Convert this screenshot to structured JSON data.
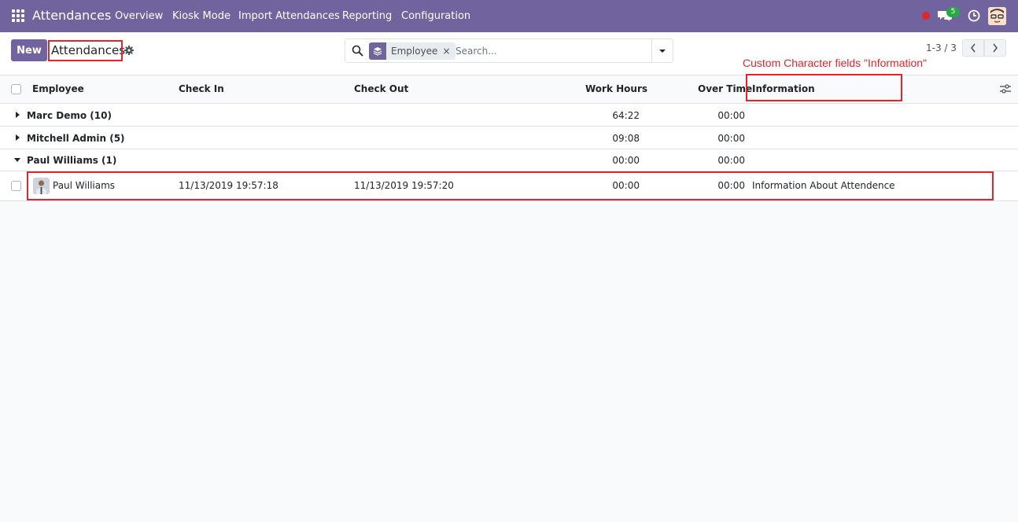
{
  "navbar": {
    "app_title": "Attendances",
    "menu": [
      "Overview",
      "Kiosk Mode",
      "Import Attendances",
      "Reporting",
      "Configuration"
    ],
    "chat_count": "5",
    "icons": [
      "apps-grid-icon",
      "record-dot-icon",
      "chat-icon",
      "clock-icon",
      "user-avatar"
    ],
    "accent_color": "#71639e"
  },
  "control": {
    "new_label": "New",
    "title": "Attendances",
    "search": {
      "facet_label": "Employee",
      "facet_close": "×",
      "placeholder": "Search..."
    },
    "pager": "1-3 / 3"
  },
  "annotation": "Custom Character fields \"Information\"",
  "table": {
    "headers": {
      "employee": "Employee",
      "check_in": "Check In",
      "check_out": "Check Out",
      "work_hours": "Work Hours",
      "over_time": "Over Time",
      "information": "Information"
    },
    "groups": [
      {
        "label": "Marc Demo (10)",
        "work_hours": "64:22",
        "over_time": "00:00"
      },
      {
        "label": "Mitchell Admin (5)",
        "work_hours": "09:08",
        "over_time": "00:00"
      },
      {
        "label": "Paul Williams (1)",
        "work_hours": "00:00",
        "over_time": "00:00"
      }
    ],
    "records": [
      {
        "employee": "Paul Williams",
        "check_in": "11/13/2019 19:57:18",
        "check_out": "11/13/2019 19:57:20",
        "work_hours": "00:00",
        "over_time": "00:00",
        "information": "Information About Attendence"
      }
    ]
  }
}
